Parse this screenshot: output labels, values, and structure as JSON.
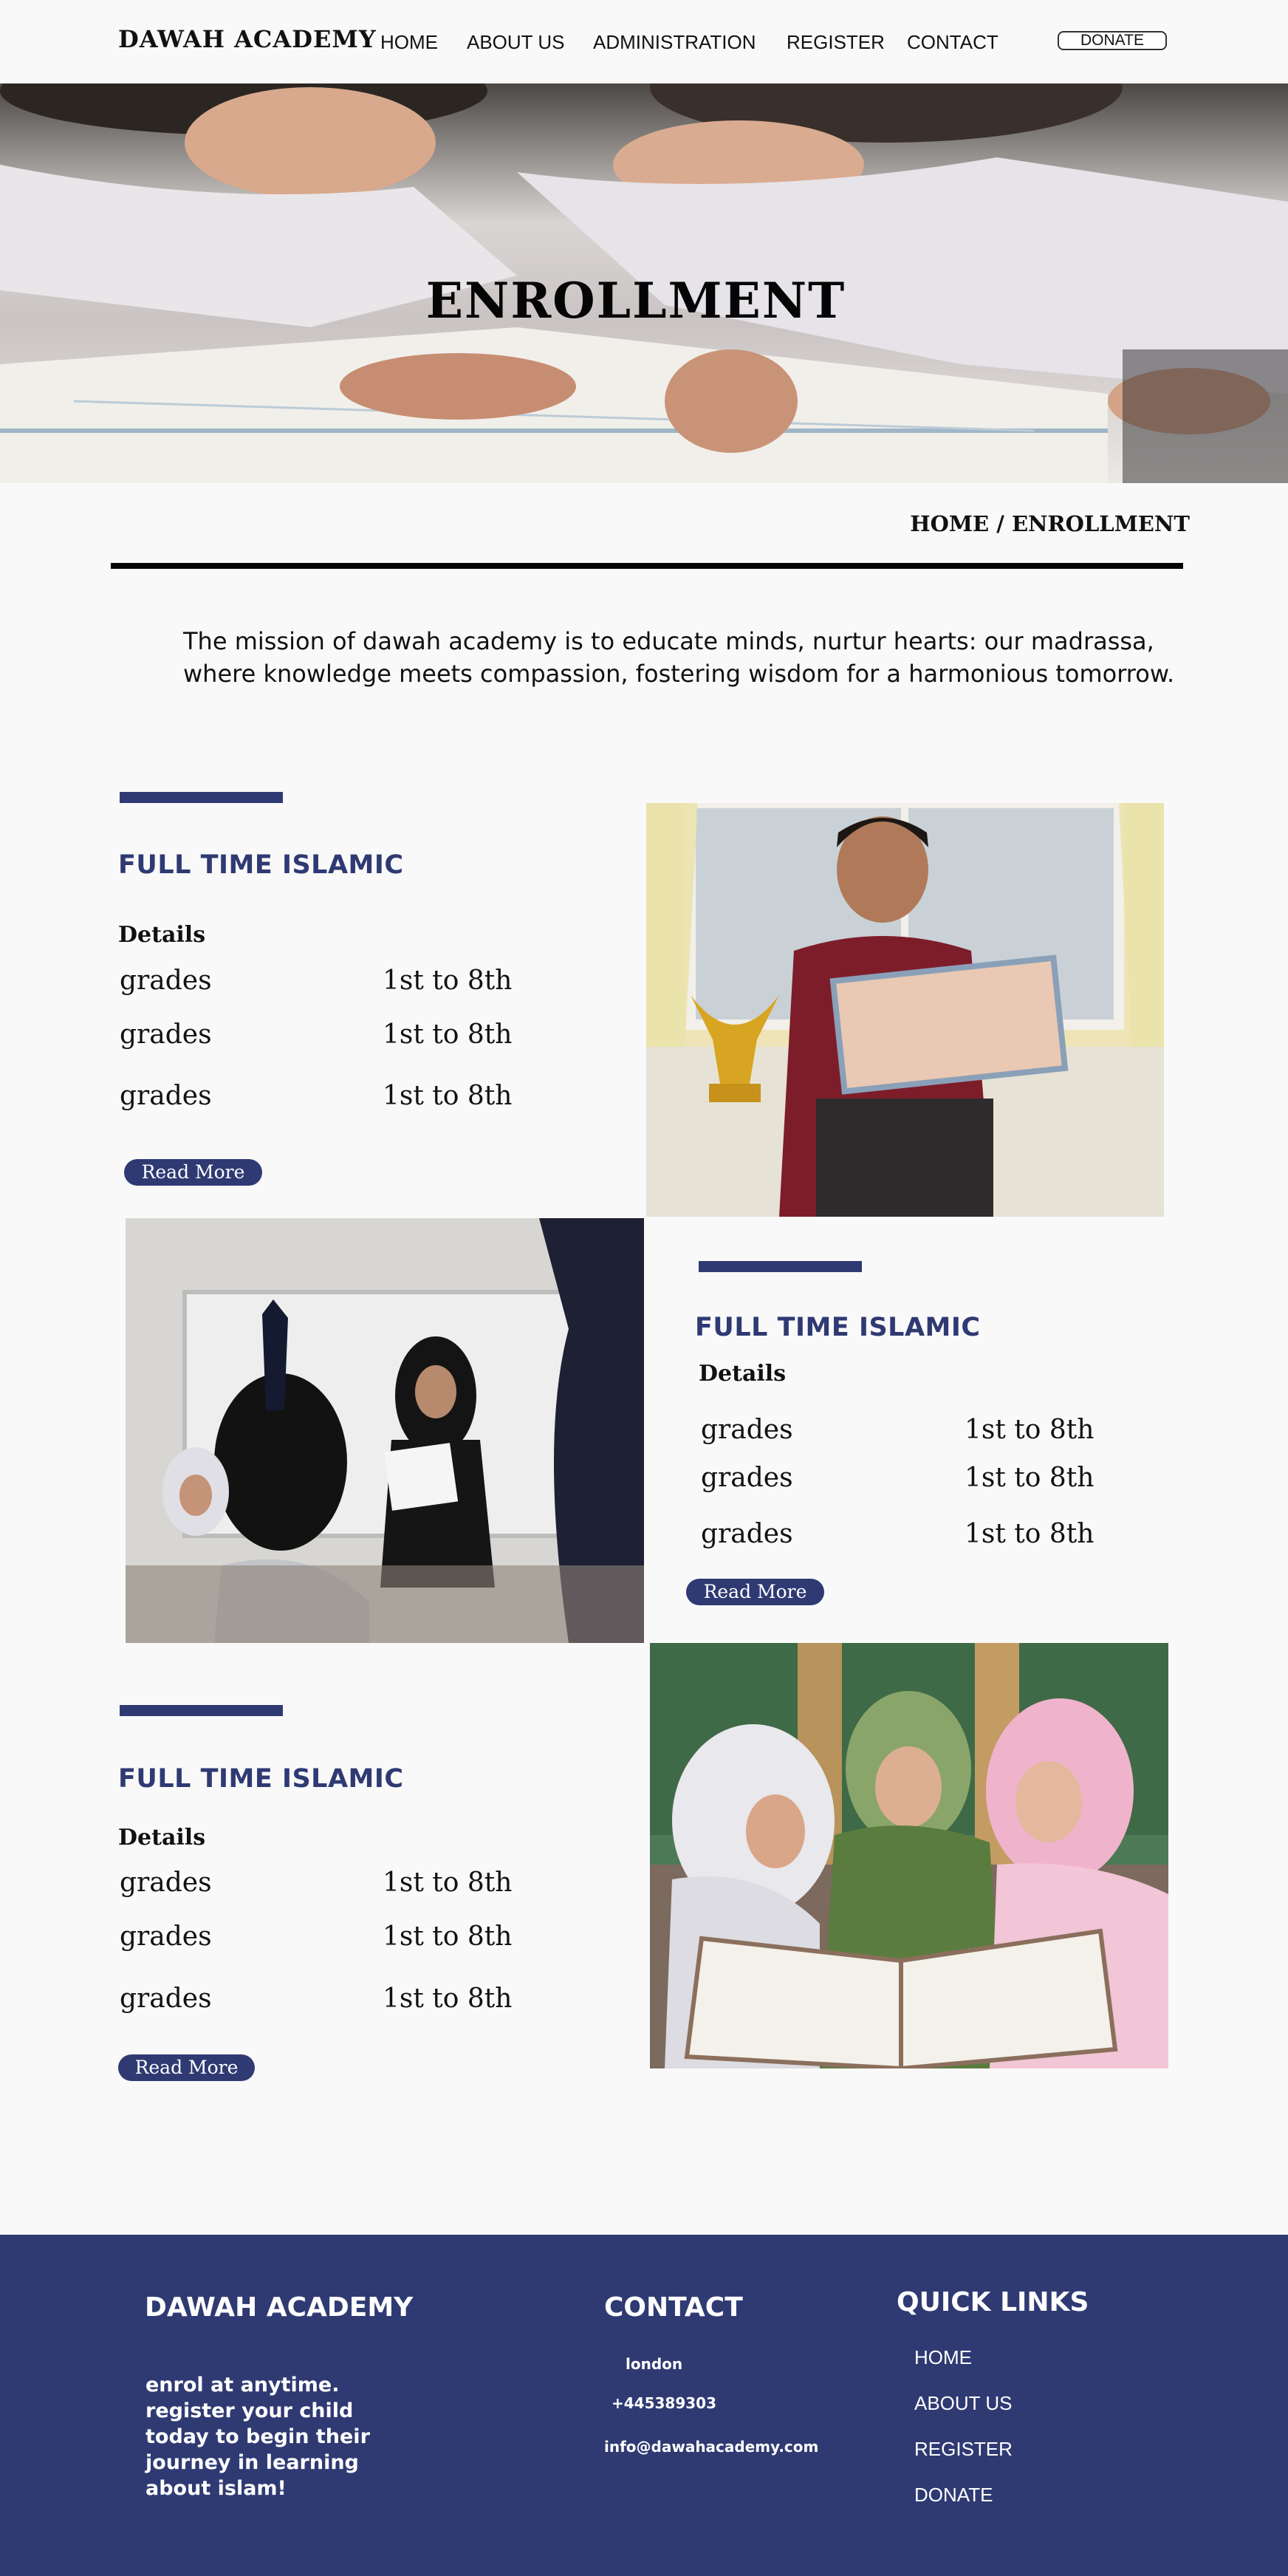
{
  "header": {
    "logo": "DAWAH ACADEMY",
    "nav": [
      "HOME",
      "ABOUT US",
      "ADMINISTRATION",
      "REGISTER",
      "CONTACT"
    ],
    "donate_label": "DONATE"
  },
  "hero": {
    "title": "ENROLLMENT"
  },
  "breadcrumb": {
    "home": "HOME",
    "separator": "/",
    "current": "ENROLLMENT"
  },
  "mission": "The mission of dawah academy is to educate minds, nurtur hearts: our madrassa, where knowledge meets compassion, fostering wisdom for a harmonious tomorrow.",
  "programs": [
    {
      "title": "FULL TIME ISLAMIC",
      "details_label": "Details",
      "rows": [
        {
          "label": "grades",
          "value": "1st to 8th"
        },
        {
          "label": "grades",
          "value": "1st to 8th"
        },
        {
          "label": "grades",
          "value": "1st to 8th"
        }
      ],
      "read_more": "Read More",
      "image": "boy-with-trophy-certificate-photo"
    },
    {
      "title": "FULL TIME ISLAMIC",
      "details_label": "Details",
      "rows": [
        {
          "label": "grades",
          "value": "1st to 8th"
        },
        {
          "label": "grades",
          "value": "1st to 8th"
        },
        {
          "label": "grades",
          "value": "1st to 8th"
        }
      ],
      "read_more": "Read More",
      "image": "classroom-teacher-photo"
    },
    {
      "title": "FULL TIME ISLAMIC",
      "details_label": "Details",
      "rows": [
        {
          "label": "grades",
          "value": "1st to 8th"
        },
        {
          "label": "grades",
          "value": "1st to 8th"
        },
        {
          "label": "grades",
          "value": "1st to 8th"
        }
      ],
      "read_more": "Read More",
      "image": "girls-reading-quran-photo"
    }
  ],
  "footer": {
    "brand": "DAWAH ACADEMY",
    "about": "enrol at anytime. register your child today to begin their journey in learning about islam!",
    "contact_title": "CONTACT",
    "contact": {
      "location": "london",
      "phone": "+445389303",
      "email": "info@dawahacademy.com"
    },
    "quick_links_title": "QUICK LINKS",
    "quick_links": [
      "HOME",
      "ABOUT US",
      "REGISTER",
      "DONATE"
    ]
  },
  "colors": {
    "primary": "#2f3a73",
    "background": "#f9f9f9",
    "text": "#111111",
    "footer_text": "#ffffff"
  }
}
